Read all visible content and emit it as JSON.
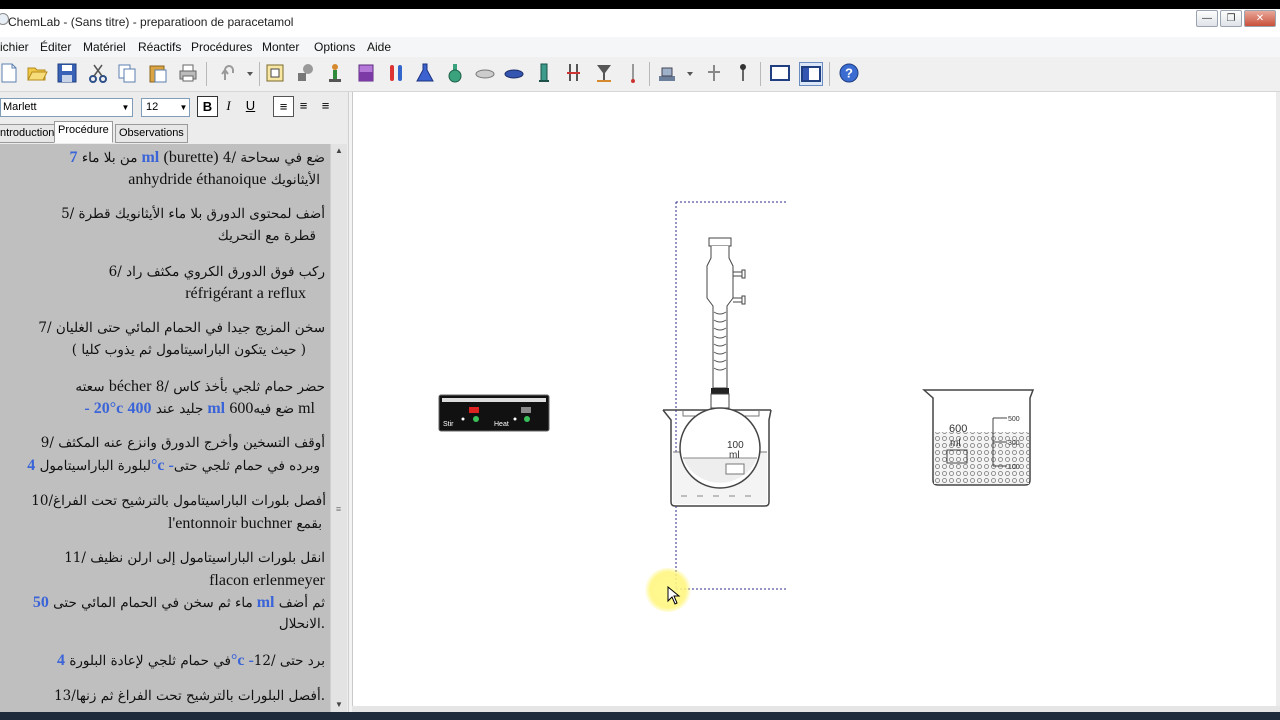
{
  "window": {
    "title": "ChemLab - (Sans titre) - preparatioon de paracetamol",
    "controls": {
      "minimize": "—",
      "restore": "❐",
      "close": "✕"
    }
  },
  "menu": [
    "ichier",
    "Éditer",
    "Matériel",
    "Réactifs",
    "Procédures",
    "Monter",
    "Options",
    "Aide"
  ],
  "toolbar_icons": [
    "new-icon",
    "open-icon",
    "save-icon",
    "cut-icon",
    "copy-icon",
    "paste-icon",
    "print-icon",
    "undo-icon",
    "undo-dropdown-icon",
    "notebook-icon",
    "tools-icon",
    "burner-icon",
    "beaker-icon",
    "test-tubes-icon",
    "flask-icon",
    "round-flask-icon",
    "dish-icon",
    "watch-glass-icon",
    "cylinder-icon",
    "stand-icon",
    "funnel-icon",
    "thermometer-icon",
    "balance-icon",
    "balance-dropdown-icon",
    "pin-icon",
    "clamp-icon",
    "window-icon",
    "split-window-icon",
    "help-icon"
  ],
  "format": {
    "font": "Marlett",
    "size": "12",
    "bold": "B",
    "italic": "I",
    "underline": "U",
    "align_left": "≡",
    "align_center": "≡",
    "align_right": "≡"
  },
  "tabs": [
    "ntroduction",
    "Procédure",
    "Observations"
  ],
  "active_tab": "Procédure",
  "procedure": {
    "s4a": "4/ ضع في سحاحة",
    "s4a_fr": "(burette)",
    "s4a_vol": "7 ml",
    "s4a_end": "من بلا ماء",
    "s4b": "الأيثانويك",
    "s4b_fr": "anhydride éthanoique",
    "s5a": "5/ أضف لمحتوى الدورق  بلا ماء الأيثانويك قطرة",
    "s5b": "قطرة مع التحريك",
    "s6a": "6/ ركب فوق الدورق الكروي مكثف راد",
    "s6b_fr": "réfrigérant a reflux",
    "s7a": "7/ سخن المزيج جيدا  في الحمام المائي حتى الغليان",
    "s7b": "( حيث يتكون الباراسيتامول ثم  يذوب كليا )",
    "s8a": "8/ حضر حمام ثلجي بأخذ كاس",
    "s8a_fr": "bécher",
    "s8a_end": "سعته",
    "s8b_neg": "- 20°c",
    "s8b_mid": "جليد عند",
    "s8b_vol": "400 ml",
    "s8b_ar": "ضع فيه",
    "s8b_cap": "600 ml",
    "s9a": "9/ أوقف التسخين وأخرج الدورق وانزع عنه المكثف",
    "s9b": "وبرده في حمام ثلجي حتى",
    "s9b_temp": "4°c -",
    "s9b_end": "لبلورة الباراسيتامول",
    "s10a": "10/أفصل بلورات الباراسيتامول بالترشيح تحت الفراغ",
    "s10b": "بقمع",
    "s10b_fr": "l'entonnoir buchner",
    "s11a": "11/ انقل بلورات الباراسيتامول  إلى ارلن نظيف",
    "s11b_fr": "flacon erlenmeyer",
    "s11c": "ثم أضف",
    "s11c_vol": "50 ml",
    "s11c_end": "ماء ثم سخن في الحمام المائي حتى",
    "s11d": "الانحلال.",
    "s12a": "12/  برد حتى",
    "s12a_temp": "4°c -",
    "s12a_end": "في حمام ثلجي لإعادة  البلورة",
    "s13a": "13/أفصل البلورات بالترشيح تحت الفراغ ثم زنها."
  },
  "apparatus": {
    "hotplate": {
      "stir_label": "Stir",
      "heat_label": "Heat"
    },
    "flask_label": "100",
    "flask_unit": "ml",
    "beaker": {
      "capacity_label": "600",
      "unit_label": "ml",
      "marks": [
        "500",
        "300",
        "100"
      ],
      "liquid_level": 0.5
    }
  },
  "colors": {
    "accent_blue": "#3a64d8",
    "doc_background": "#bfbfbf",
    "canvas": "#ffffff"
  }
}
